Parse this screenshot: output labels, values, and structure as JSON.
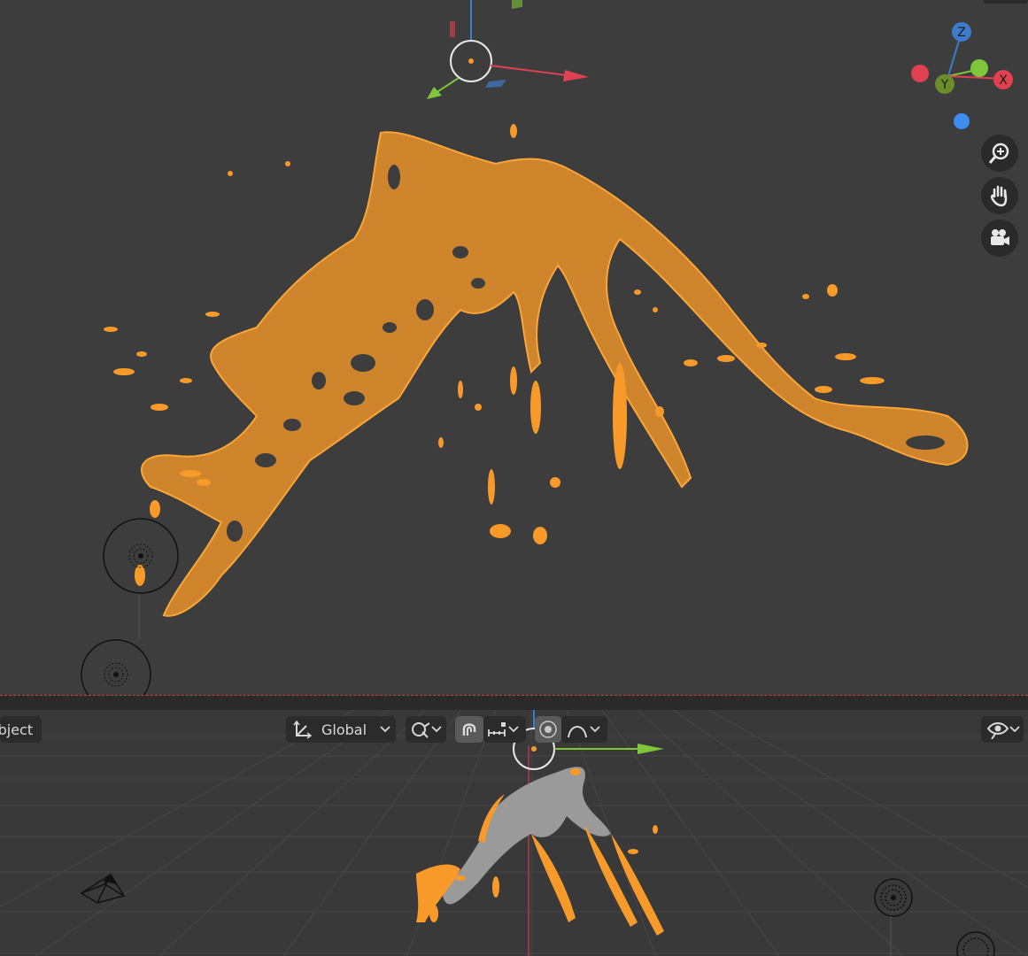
{
  "header": {
    "mode_label": "Object",
    "orientation_label": "Global"
  },
  "gizmo": {
    "axes": {
      "z": "Z",
      "y": "Y",
      "x": "X"
    },
    "colors": {
      "x": "#e0404f",
      "y": "#7fc63a",
      "z": "#3d7cc9",
      "y_dark": "#6a8f2a"
    }
  },
  "navigation": [
    {
      "name": "zoom-icon"
    },
    {
      "name": "pan-hand-icon"
    },
    {
      "name": "camera-icon"
    }
  ],
  "colors": {
    "selection": "#f79a2a",
    "background": "#3d3d3d",
    "mesh_gray": "#9a9a9a"
  },
  "toolbar_icons": [
    "transform-orientation-icon",
    "pivot-icon",
    "snap-icon",
    "snap-increment-icon",
    "proportional-edit-icon",
    "falloff-curve-icon",
    "visibility-eye-icon"
  ]
}
